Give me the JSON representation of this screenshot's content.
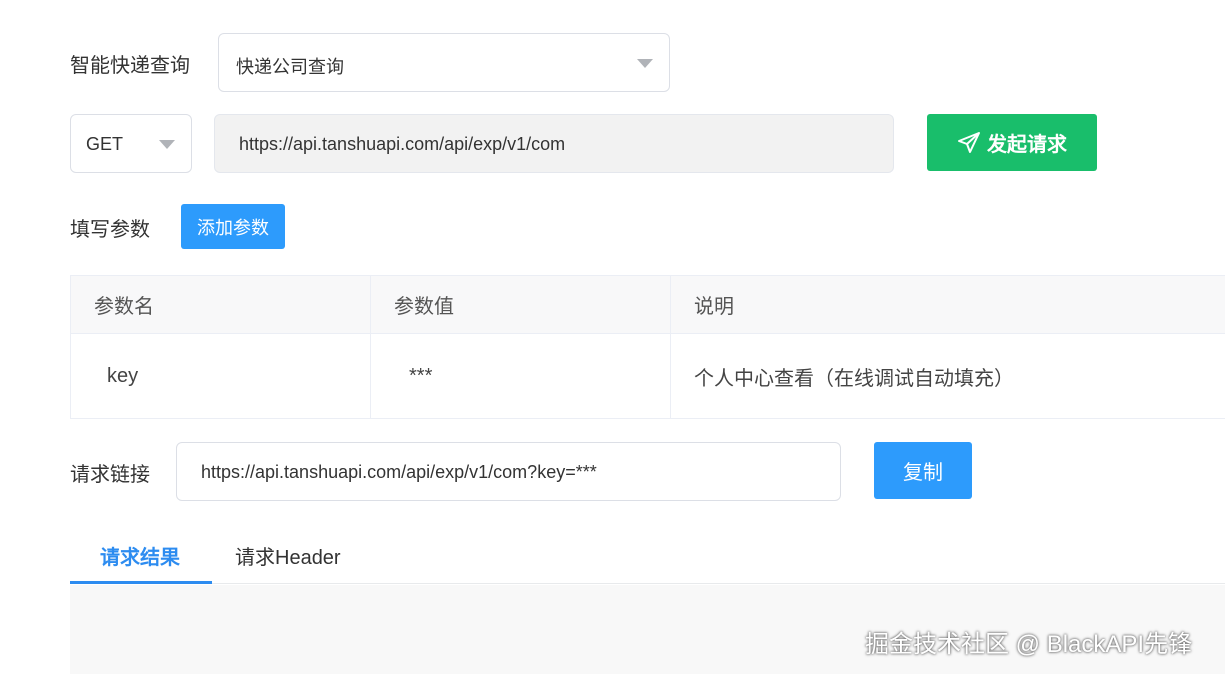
{
  "api_selector": {
    "label": "智能快递查询",
    "selected": "快递公司查询"
  },
  "request": {
    "method": "GET",
    "url": "https://api.tanshuapi.com/api/exp/v1/com",
    "send_label": "发起请求"
  },
  "params": {
    "label": "填写参数",
    "add_label": "添加参数",
    "headers": [
      "参数名",
      "参数值",
      "说明"
    ],
    "rows": [
      {
        "name": "key",
        "value": "***",
        "desc": "个人中心查看（在线调试自动填充）"
      }
    ]
  },
  "request_link": {
    "label": "请求链接",
    "value": "https://api.tanshuapi.com/api/exp/v1/com?key=***",
    "copy_label": "复制"
  },
  "tabs": [
    {
      "label": "请求结果",
      "active": true
    },
    {
      "label": "请求Header",
      "active": false
    }
  ],
  "watermark": "掘金技术社区 @ BlackAPI先锋",
  "colors": {
    "send_button": "#19be6b",
    "primary_button": "#2d9bfc",
    "active_tab": "#2d8cf0"
  },
  "icons": {
    "send": "paper-plane-icon",
    "dropdown": "chevron-down-icon"
  }
}
